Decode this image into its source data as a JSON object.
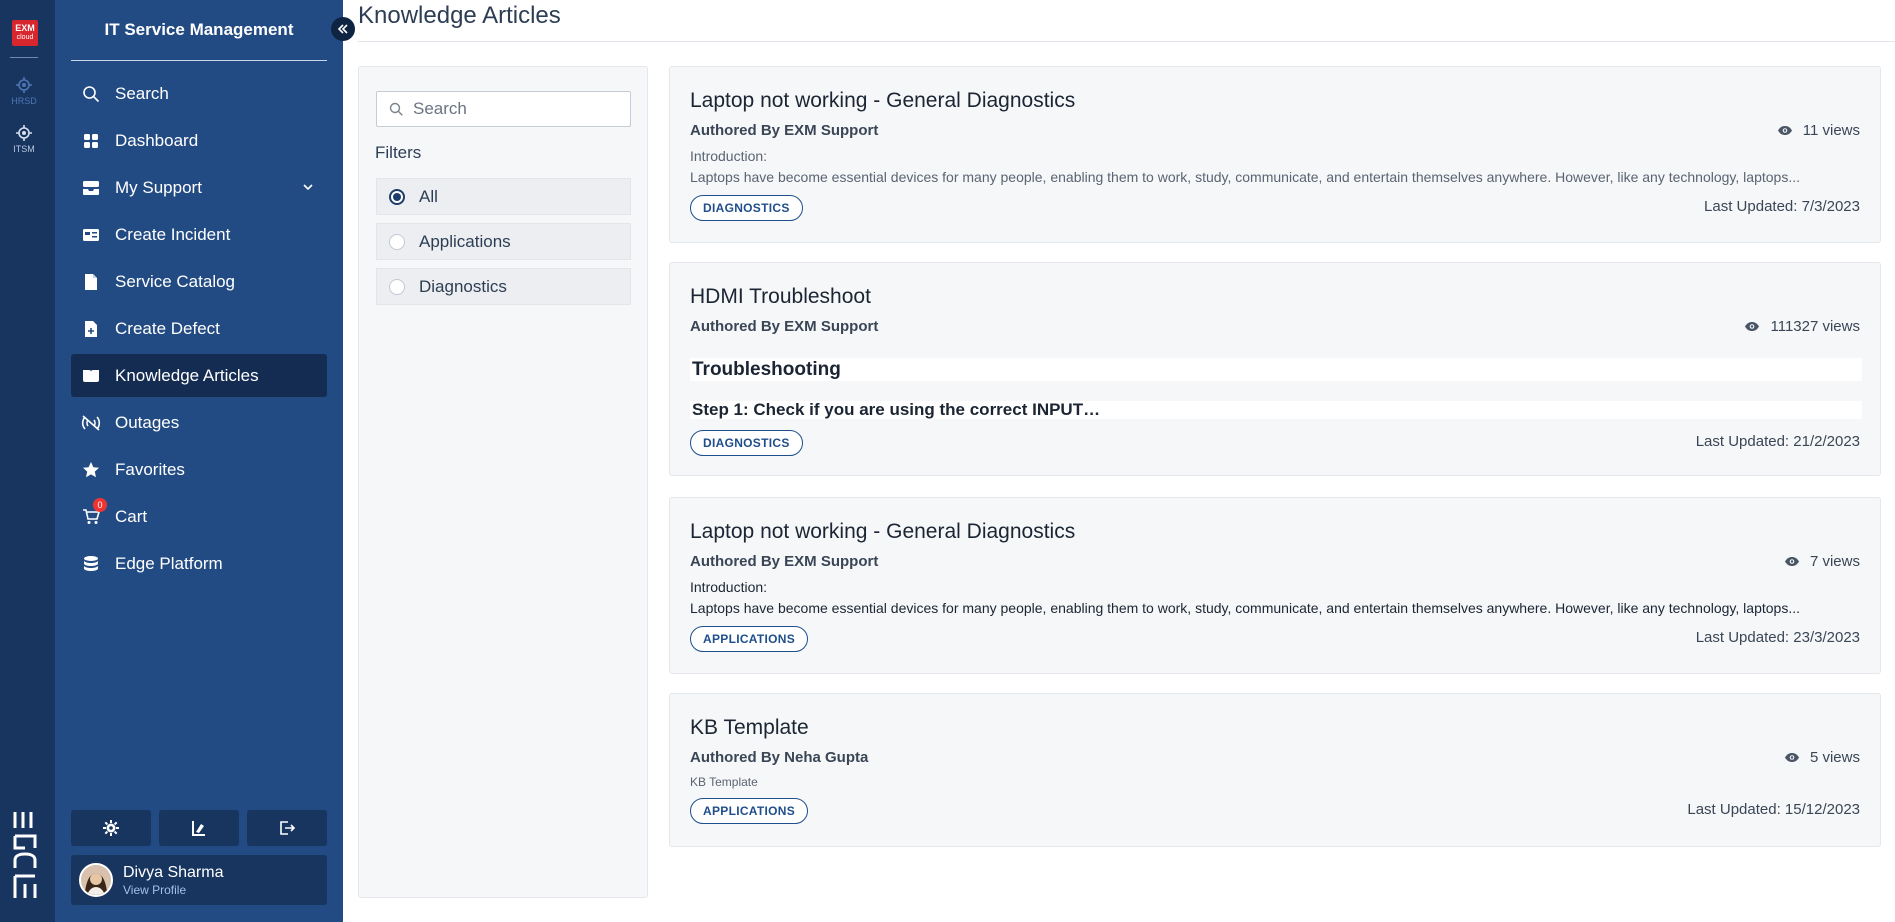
{
  "rail": {
    "logo_top": "EXM",
    "logo_bottom": "cloud",
    "apps": [
      {
        "label": "HRSD",
        "icon": "hrsd-icon"
      },
      {
        "label": "ITSM",
        "icon": "itsm-icon"
      }
    ],
    "brand_mark": "edge-logo-icon"
  },
  "sidebar": {
    "title": "IT Service Management",
    "items": [
      {
        "label": "Search",
        "icon": "search-icon"
      },
      {
        "label": "Dashboard",
        "icon": "dashboard-icon"
      },
      {
        "label": "My Support",
        "icon": "inbox-icon"
      },
      {
        "label": "Create Incident",
        "icon": "ticket-icon"
      },
      {
        "label": "Service Catalog",
        "icon": "document-icon"
      },
      {
        "label": "Create Defect",
        "icon": "document-add-icon"
      },
      {
        "label": "Knowledge Articles",
        "icon": "book-icon"
      },
      {
        "label": "Outages",
        "icon": "signal-icon"
      },
      {
        "label": "Favorites",
        "icon": "star-icon"
      },
      {
        "label": "Cart",
        "icon": "cart-icon",
        "badge": "0"
      },
      {
        "label": "Edge Platform",
        "icon": "database-icon"
      }
    ],
    "active": "Knowledge Articles",
    "profile": {
      "name": "Divya Sharma",
      "link": "View Profile"
    }
  },
  "main": {
    "title": "Knowledge Articles",
    "search": {
      "placeholder": "Search",
      "value": ""
    },
    "filters_label": "Filters",
    "filters": [
      {
        "label": "All",
        "selected": true
      },
      {
        "label": "Applications",
        "selected": false
      },
      {
        "label": "Diagnostics",
        "selected": false
      }
    ],
    "articles": [
      {
        "title": "Laptop not working - General Diagnostics",
        "author": "Authored By EXM Support",
        "views": "11 views",
        "intro": "Introduction:",
        "excerpt": "Laptops have become essential devices for many people, enabling them to work, study, communicate, and entertain themselves anywhere. However, like any technology, laptops...",
        "tag": "DIAGNOSTICS",
        "updated": "Last Updated: 7/3/2023"
      },
      {
        "title": "HDMI Troubleshoot",
        "author": "Authored By EXM Support",
        "views": "111327 views",
        "heading": "Troubleshooting",
        "step": "Step 1: Check if you are using the correct INPUT…",
        "tag": "DIAGNOSTICS",
        "updated": "Last Updated: 21/2/2023"
      },
      {
        "title": "Laptop not working - General Diagnostics",
        "author": "Authored By EXM Support",
        "views": "7 views",
        "intro": "Introduction:",
        "excerpt": "Laptops have become essential devices for many people, enabling them to work, study, communicate, and entertain themselves anywhere. However, like any technology, laptops...",
        "tag": "APPLICATIONS",
        "updated": "Last Updated: 23/3/2023"
      },
      {
        "title": "KB Template",
        "author": "Authored By Neha Gupta",
        "views": "5 views",
        "excerpt": "KB Template",
        "tag": "APPLICATIONS",
        "updated": "Last Updated: 15/12/2023"
      }
    ]
  },
  "colors": {
    "rail_bg": "#17355f",
    "sidebar_bg": "#234b83",
    "active_bg": "#142c52",
    "tag_blue": "#1f4e8c",
    "badge_red": "#e33333"
  }
}
